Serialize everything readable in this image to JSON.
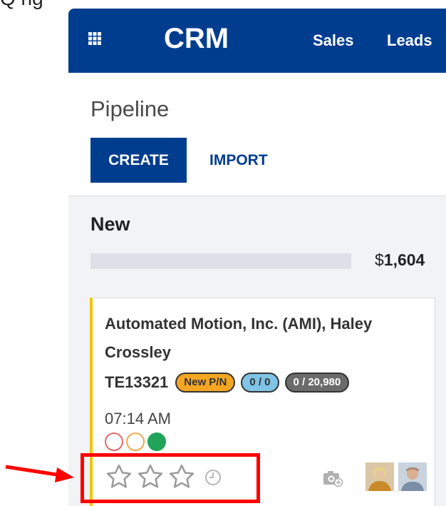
{
  "top_fragment_text": "Q  ng",
  "app": {
    "brand": "CRM",
    "nav": [
      "Sales",
      "Leads"
    ]
  },
  "control_panel": {
    "breadcrumb": "Pipeline",
    "create_label": "CREATE",
    "import_label": "IMPORT"
  },
  "column": {
    "title": "New",
    "total_currency": "$",
    "total_amount": "1,604",
    "progress_fraction": 0
  },
  "card": {
    "title": "Automated Motion, Inc. (AMI), Haley Crossley",
    "reference": "TE13321",
    "badges": [
      "New P/N",
      "0 / 0",
      "0 / 20,980"
    ],
    "time": "07:14 AM",
    "kanban_state": "green",
    "priority_stars": 0,
    "priority_max": 3
  },
  "icons": {
    "apps": "apps-grid-icon",
    "clock": "clock-icon",
    "camera": "camera-add-icon"
  },
  "colors": {
    "brand": "#003d8f",
    "stage_accent": "#f2c500",
    "badge_new": "#f4a623",
    "badge_ratio": "#7fc3e6",
    "badge_amount": "#6b6b6b",
    "annotation": "#ff0000",
    "state_green": "#21a35a"
  }
}
